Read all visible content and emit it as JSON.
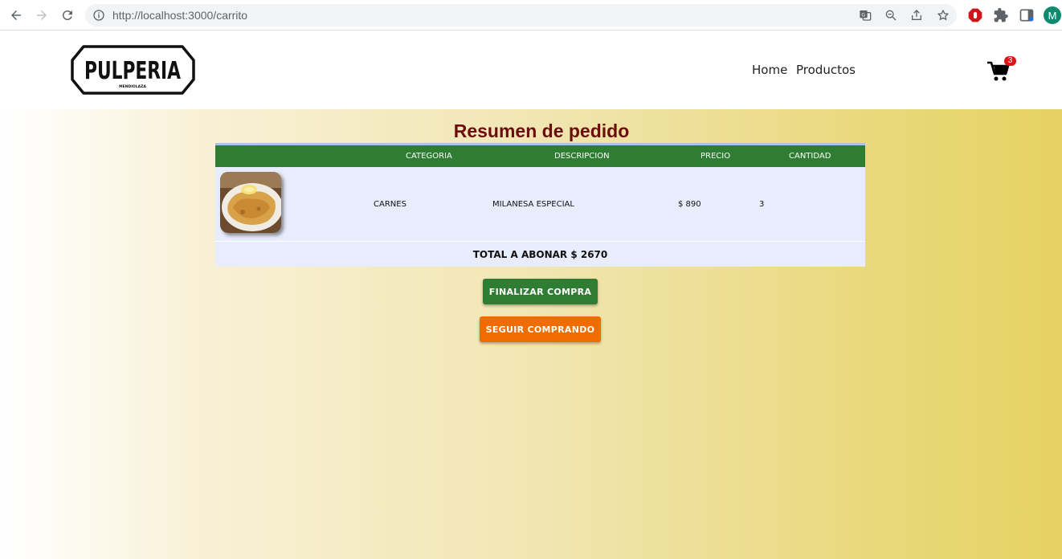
{
  "browser": {
    "url": "http://localhost:3000/carrito",
    "profile_initial": "M"
  },
  "header": {
    "logo_text": "PULPERIA",
    "logo_subtext": "MENDIOLAZA",
    "nav": [
      "Home",
      "Productos"
    ],
    "cart_count": "3"
  },
  "main": {
    "title": "Resumen de pedido",
    "columns": [
      "CATEGORIA",
      "DESCRIPCION",
      "PRECIO",
      "CANTIDAD"
    ],
    "rows": [
      {
        "image": "milanesa-photo",
        "categoria": "CARNES",
        "descripcion": "MILANESA ESPECIAL",
        "precio": "$ 890",
        "cantidad": "3"
      }
    ],
    "total_label": "TOTAL A ABONAR $ 2670",
    "finalizar_label": "FINALIZAR COMPRA",
    "seguir_label": "SEGUIR COMPRANDO"
  },
  "colors": {
    "header_green": "#2e7d32",
    "title_red": "#6b0d0d",
    "orange": "#ef6c00",
    "badge_red": "#e0121a"
  }
}
